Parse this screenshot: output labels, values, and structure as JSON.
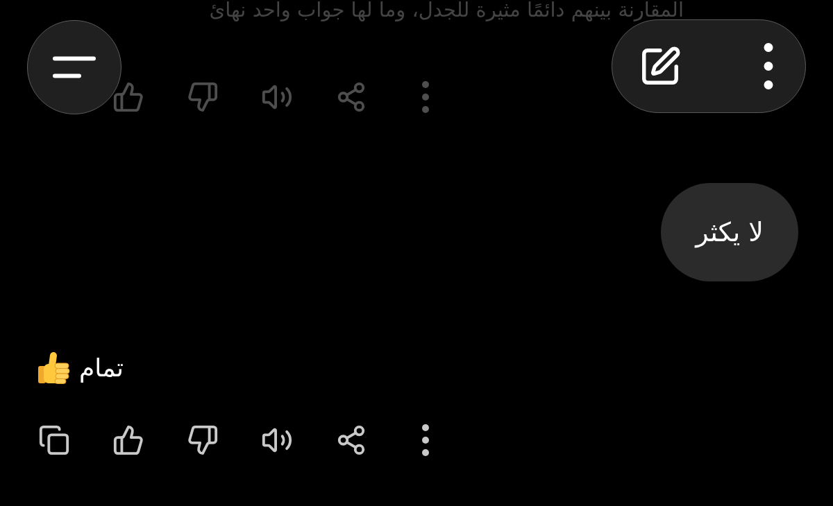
{
  "messages": [
    {
      "kind": "assistant",
      "faded": true,
      "text": "المقارنة بينهم دائمًا مثيرة للجدل، وما لها جواب واحد نهائ",
      "actions": [
        {
          "kind": "like"
        },
        {
          "kind": "dislike"
        },
        {
          "kind": "read_aloud"
        },
        {
          "kind": "share"
        },
        {
          "kind": "more"
        }
      ]
    },
    {
      "kind": "user",
      "text": "لا يكثر"
    },
    {
      "kind": "assistant",
      "faded": false,
      "text": "تمام",
      "emoji": {
        "kind": "thumbs_up"
      },
      "actions": [
        {
          "kind": "copy"
        },
        {
          "kind": "like"
        },
        {
          "kind": "dislike"
        },
        {
          "kind": "read_aloud"
        },
        {
          "kind": "share"
        },
        {
          "kind": "more"
        }
      ]
    }
  ]
}
